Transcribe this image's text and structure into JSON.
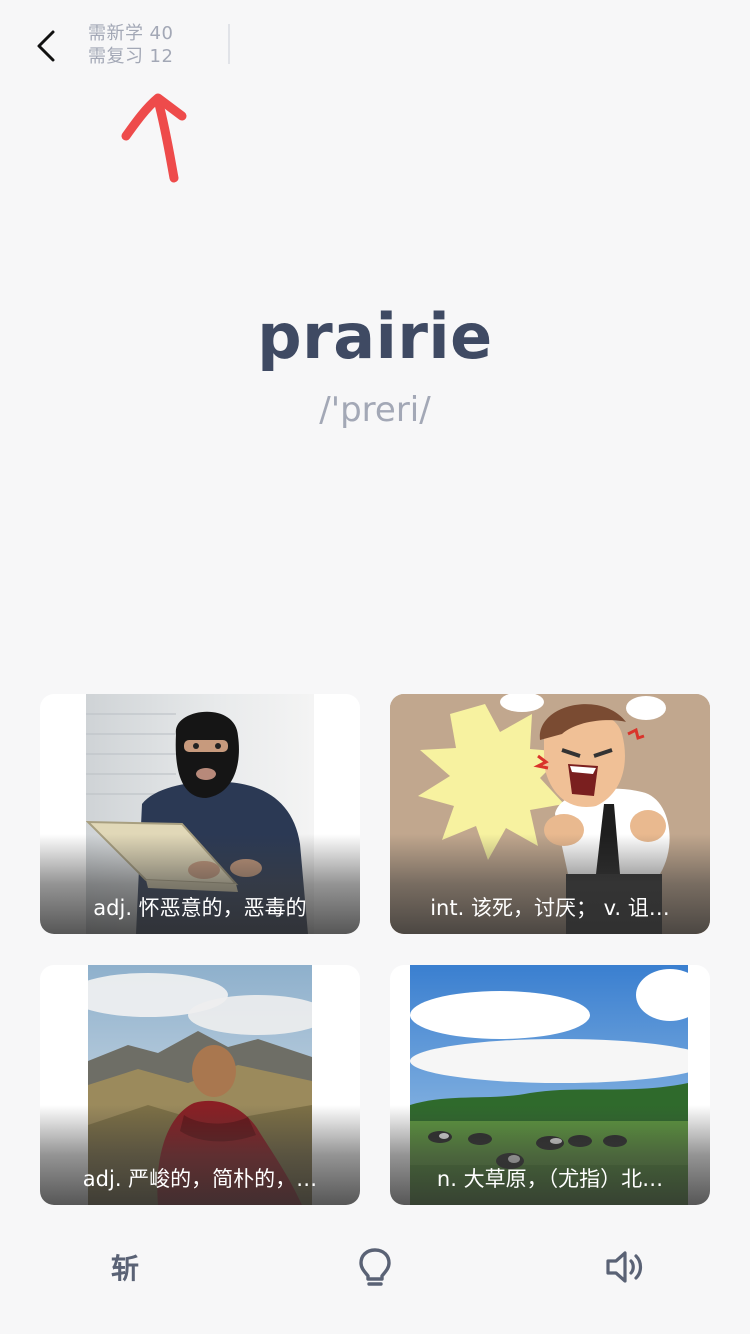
{
  "header": {
    "new_label": "需新学",
    "new_count": "40",
    "review_label": "需复习",
    "review_count": "12"
  },
  "word": {
    "text": "prairie",
    "phonetic": "/'preri/"
  },
  "options": [
    {
      "label": "adj. 怀恶意的，恶毒的",
      "image": "masked-hacker-with-laptop"
    },
    {
      "label": "int. 该死，讨厌； v. 诅…",
      "image": "angry-cartoon-man-shouting"
    },
    {
      "label": "adj. 严峻的，简朴的，…",
      "image": "monk-overlooking-mountains"
    },
    {
      "label": "n. 大草原，（尤指）北…",
      "image": "cows-grazing-on-grassland"
    }
  ],
  "toolbar": {
    "chop_label": "斩",
    "hint_icon": "lightbulb-icon",
    "audio_icon": "speaker-icon"
  }
}
